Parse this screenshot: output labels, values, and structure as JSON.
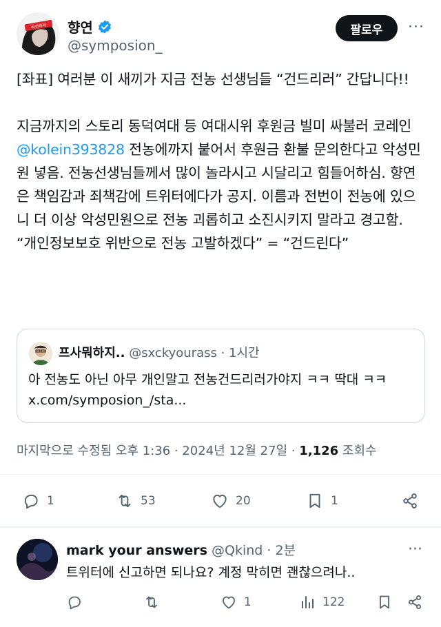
{
  "tweet": {
    "author_name": "향연",
    "author_handle": "@symposion_",
    "follow_label": "팔로우",
    "more_label": "···",
    "paragraph1": "[좌표] 여러분 이 새끼가 지금 전농 선생님들 “건드리러” 간답니다!!",
    "paragraph2_before": "지금까지의 스토리 동덕여대 등 여대시위 후원금 빌미 싸불러 코레인 ",
    "mention": "@kolein393828",
    "paragraph2_after": " 전농에까지 붙어서 후원금 환불 문의한다고 악성민원 넣음. 전농선생님들께서 많이 놀라시고 시달리고 힘들어하심. 향연은 책임감과 죄책감에 트위터에다가 공지. 이름과 전번이 전농에 있으니 더 이상 악성민원으로 전농 괴롭히고 소진시키지 말라고 경고함. “개인정보보호 위반으로 전농 고발하겠다” = “건드린다”",
    "avatar_sign_text": "비전하라",
    "quote": {
      "name": "프사뭐하지..",
      "handle": "@sxckyourass",
      "time": " · 1시간",
      "text": "아 전농도 아닌 아무 개인말고 전농건드리러가야지 ㅋㅋ 딱대 ㅋㅋ x.com/symposion_/sta..."
    },
    "meta": {
      "edited": "마지막으로 수정됨 오후 1:36 · 2024년 12월 27일 · ",
      "views_count": "1,126",
      "views_label": " 조회수"
    },
    "actions": {
      "replies": "1",
      "retweets": "53",
      "likes": "20",
      "bookmarks": "1"
    }
  },
  "reply": {
    "name": "mark your answers",
    "handle": "@Qkind",
    "time": " · 2분",
    "more_label": "···",
    "text": "트위터에 신고하면 되나요? 계정 막히면 괜찮으려나..",
    "actions": {
      "replies": "",
      "retweets": "",
      "likes": "1",
      "views": "122"
    }
  },
  "colors": {
    "accent": "#1d9bf0",
    "text": "#0f1419",
    "muted": "#536471",
    "border": "#cfd9de"
  },
  "icons": [
    "verified-badge-icon",
    "more-icon",
    "reply-icon",
    "retweet-icon",
    "like-icon",
    "bookmark-icon",
    "share-icon",
    "views-icon"
  ]
}
